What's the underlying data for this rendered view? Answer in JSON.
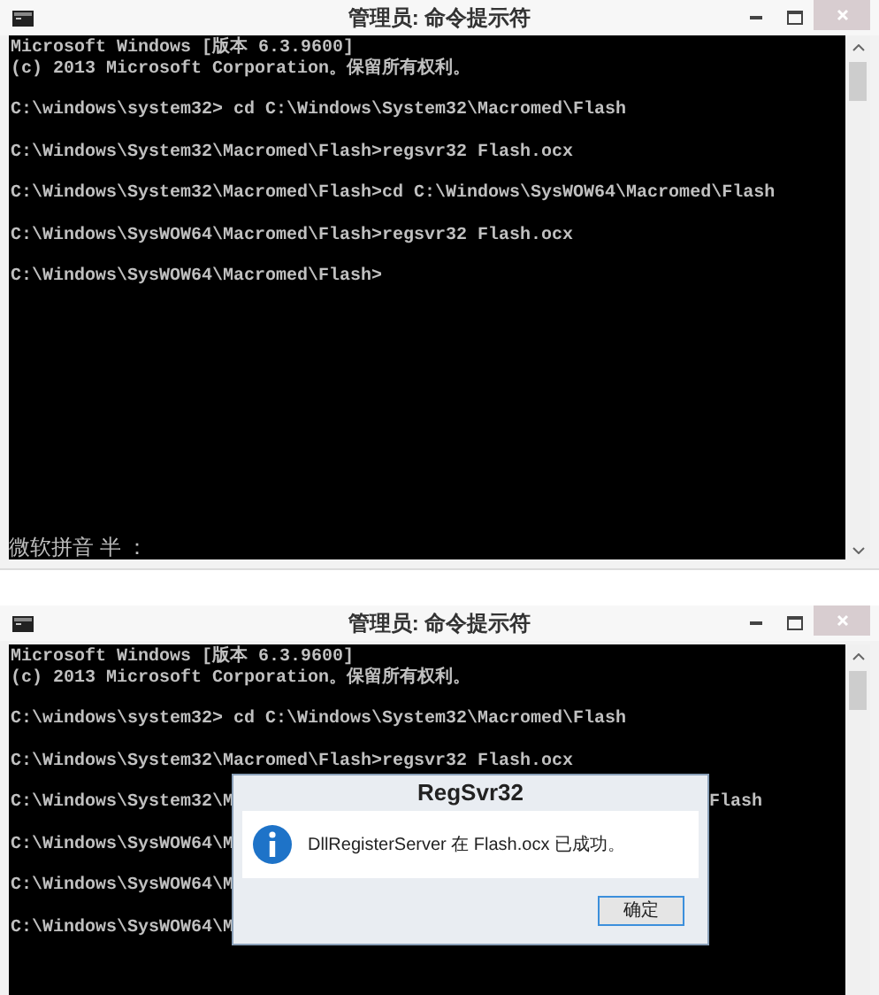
{
  "windows": [
    {
      "title": "管理员: 命令提示符",
      "console": {
        "header": [
          "Microsoft Windows [版本 6.3.9600]",
          "(c) 2013 Microsoft Corporation。保留所有权利。"
        ],
        "commands": [
          {
            "text": "C:\\windows\\system32> cd C:\\Windows\\System32\\Macromed\\Flash"
          },
          {
            "text": "C:\\Windows\\System32\\Macromed\\Flash>regsvr32 Flash.ocx"
          },
          {
            "text": "C:\\Windows\\System32\\Macromed\\Flash>cd C:\\Windows\\SysWOW64\\Macromed\\Flash"
          },
          {
            "text": "C:\\Windows\\SysWOW64\\Macromed\\Flash>regsvr32 Flash.ocx"
          },
          {
            "text": "C:\\Windows\\SysWOW64\\Macromed\\Flash>"
          }
        ]
      },
      "ime_status": "微软拼音 半 ："
    },
    {
      "title": "管理员: 命令提示符",
      "console": {
        "header": [
          "Microsoft Windows [版本 6.3.9600]",
          "(c) 2013 Microsoft Corporation。保留所有权利。"
        ],
        "commands": [
          {
            "text": "C:\\windows\\system32> cd C:\\Windows\\System32\\Macromed\\Flash"
          },
          {
            "text": "C:\\Windows\\System32\\Macromed\\Flash>regsvr32 Flash.ocx"
          },
          {
            "text": "C:\\Windows\\System32\\M",
            "tail": "Flash"
          },
          {
            "text": "C:\\Windows\\SysWOW64\\M"
          },
          {
            "text": "C:\\Windows\\SysWOW64\\M"
          },
          {
            "text": "C:\\Windows\\SysWOW64\\M"
          }
        ]
      },
      "dialog": {
        "title": "RegSvr32",
        "message": "DllRegisterServer 在 Flash.ocx 已成功。",
        "button": "确定"
      }
    }
  ]
}
